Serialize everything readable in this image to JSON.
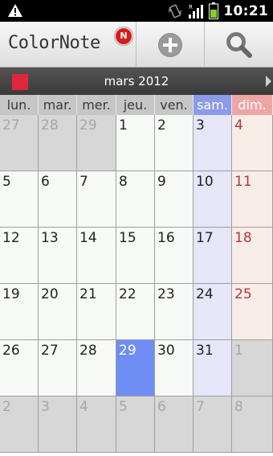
{
  "status_bar": {
    "time": "10:21",
    "icons": [
      "warning-icon",
      "vibrate-icon",
      "signal-icon",
      "battery-icon"
    ]
  },
  "app_bar": {
    "title": "ColorNote",
    "badge": "N",
    "actions": [
      "add-icon",
      "search-icon"
    ]
  },
  "calendar_nav": {
    "month": "mars 2012",
    "color": "#e0263b"
  },
  "day_names": [
    "lun.",
    "mar.",
    "mer.",
    "jeu.",
    "ven.",
    "sam.",
    "dim."
  ],
  "weeks": [
    [
      {
        "d": "27",
        "other": true
      },
      {
        "d": "28",
        "other": true
      },
      {
        "d": "29",
        "other": true
      },
      {
        "d": "1"
      },
      {
        "d": "2"
      },
      {
        "d": "3"
      },
      {
        "d": "4"
      }
    ],
    [
      {
        "d": "5"
      },
      {
        "d": "6"
      },
      {
        "d": "7"
      },
      {
        "d": "8"
      },
      {
        "d": "9"
      },
      {
        "d": "10"
      },
      {
        "d": "11"
      }
    ],
    [
      {
        "d": "12"
      },
      {
        "d": "13"
      },
      {
        "d": "14"
      },
      {
        "d": "15"
      },
      {
        "d": "16"
      },
      {
        "d": "17"
      },
      {
        "d": "18"
      }
    ],
    [
      {
        "d": "19"
      },
      {
        "d": "20"
      },
      {
        "d": "21"
      },
      {
        "d": "22"
      },
      {
        "d": "23"
      },
      {
        "d": "24"
      },
      {
        "d": "25"
      }
    ],
    [
      {
        "d": "26"
      },
      {
        "d": "27"
      },
      {
        "d": "28"
      },
      {
        "d": "29",
        "today": true
      },
      {
        "d": "30"
      },
      {
        "d": "31"
      },
      {
        "d": "1",
        "other": true
      }
    ],
    [
      {
        "d": "2",
        "other": true
      },
      {
        "d": "3",
        "other": true
      },
      {
        "d": "4",
        "other": true
      },
      {
        "d": "5",
        "other": true
      },
      {
        "d": "6",
        "other": true
      },
      {
        "d": "7",
        "other": true
      },
      {
        "d": "8",
        "other": true
      }
    ]
  ],
  "colors": {
    "today": "#6f8ef5",
    "saturday_header": "#8c9aea",
    "sunday_header": "#f0a5a5",
    "sunday_text": "#b23a3a"
  }
}
